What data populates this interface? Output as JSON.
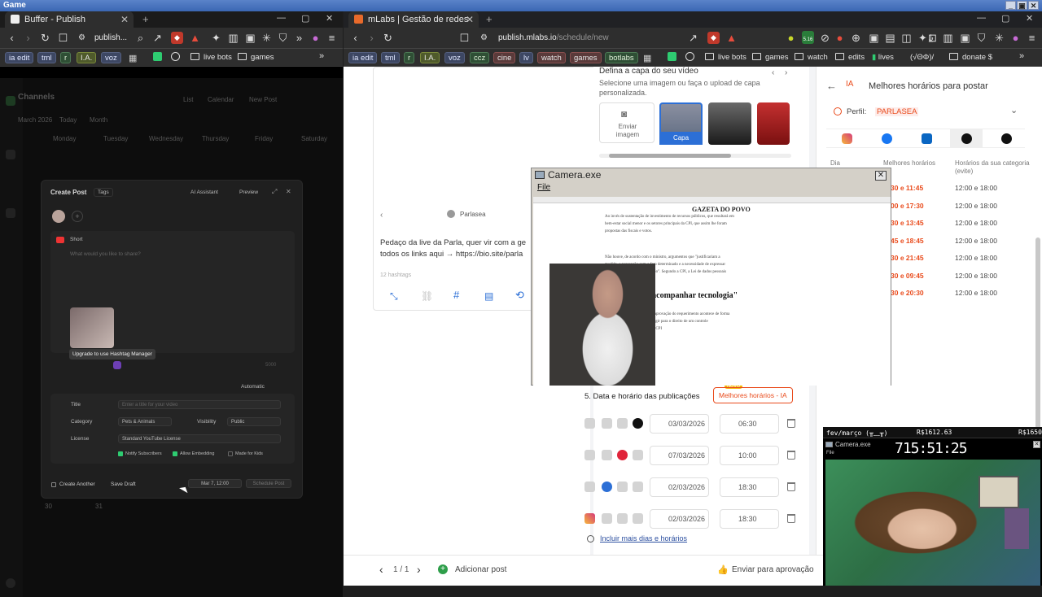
{
  "os": {
    "title": "Game",
    "controls": [
      "_",
      "▣",
      "✕"
    ]
  },
  "left_browser": {
    "tab": {
      "label": "Buffer - Publish",
      "close": "✕",
      "new": "+"
    },
    "win_controls": [
      "—",
      "▢",
      "✕"
    ],
    "url": "publish...",
    "bookmarks": [
      "ia edit",
      "tml",
      "r",
      "I.A.",
      "voz",
      "live bots",
      "games"
    ],
    "more": "»"
  },
  "buffer": {
    "sidebar_title": "Channels",
    "month": "March 2026",
    "today": "Today",
    "view": "Month",
    "list": "List",
    "calendar": "Calendar",
    "new_post": "New Post",
    "weekdays": [
      "Monday",
      "Tuesday",
      "Wednesday",
      "Thursday",
      "Friday",
      "Saturday"
    ],
    "dates": [
      "30",
      "31"
    ],
    "create_post": {
      "title": "Create Post",
      "tags": "Tags",
      "ai_assistant": "AI Assistant",
      "preview": "Preview",
      "format": "Short",
      "placeholder": "What would you like to share?",
      "tooltip": "Upgrade to use Hashtag Manager",
      "counter": "5000",
      "automatic": "Automatic",
      "title_label": "Title",
      "title_placeholder": "Enter a title for your video",
      "category_label": "Category",
      "category_value": "Pets & Animals",
      "visibility_label": "Visibility",
      "visibility_value": "Public",
      "license_label": "License",
      "license_value": "Standard YouTube License",
      "notify": "Notify Subscribers",
      "embedding": "Allow Embedding",
      "kids": "Made for Kids",
      "create_another": "Create Another",
      "save_draft": "Save Draft",
      "schedule_date": "Mar 7, 12:00",
      "schedule_post": "Schedule Post"
    }
  },
  "right_browser": {
    "tab": {
      "label": "mLabs | Gestão de redes sociais",
      "close": "✕",
      "new": "+"
    },
    "win_controls": [
      "—",
      "▢",
      "✕"
    ],
    "url_host": "publish.mlabs.io",
    "url_path": "/schedule/new",
    "ext_badge": "5.16",
    "bookmarks": [
      "ia edit",
      "tml",
      "r",
      "I.A.",
      "voz",
      "ccz",
      "cine",
      "lv",
      "watch",
      "games",
      "botlabs",
      "live bots",
      "games",
      "watch",
      "edits",
      "lives",
      "(√ΘΦ)/",
      "donate $"
    ],
    "more": "»"
  },
  "mlabs": {
    "cover_title": "Defina a capa do seu vídeo",
    "cover_desc": "Selecione uma imagem ou faça o upload de capa personalizada.",
    "send_image": "Enviar imagem",
    "cover_label": "Capa",
    "profile_name": "Parlasea",
    "caption_line1": "Pedaço da live da Parla, quer vir com a ge",
    "caption_line2": "todos os links aqui → https://bio.site/parla",
    "hashtags": "12 hashtags",
    "section5": "5. Data e horário das publicações",
    "new_badge": "NOVO",
    "best_times_btn": "Melhores horários - IA",
    "dates": [
      {
        "date": "03/03/2026",
        "time": "06:30"
      },
      {
        "date": "07/03/2026",
        "time": "10:00"
      },
      {
        "date": "02/03/2026",
        "time": "18:30"
      },
      {
        "date": "02/03/2026",
        "time": "18:30"
      }
    ],
    "more_days": "Incluir mais dias e horários",
    "pager": "1 / 1",
    "add_post": "Adicionar post",
    "send_approval": "Enviar para aprovação",
    "best": {
      "title": "Melhores horários para postar",
      "profile_label": "Perfil:",
      "profile_value": "PARLASEA",
      "col1": "Dia",
      "col2": "Melhores horários",
      "col3": "Horários da sua categoria (evite)",
      "best_times": [
        "30 e 11:45",
        "00 e 17:30",
        "30 e 13:45",
        "45 e 18:45",
        "30 e 21:45",
        "30 e 09:45",
        "30 e 20:30"
      ],
      "avoid": [
        "12:00 e 18:00",
        "12:00 e 18:00",
        "12:00 e 18:00",
        "12:00 e 18:00",
        "12:00 e 18:00",
        "12:00 e 18:00",
        "12:00 e 18:00"
      ]
    }
  },
  "camera": {
    "title": "Camera.exe",
    "menu": "File",
    "close": "✕",
    "article_site": "GAZETA DO POVO",
    "article_heading": "PL precisa \"acompanhar tecnologia\"",
    "article_text": [
      "Ao invés de sustentação de investimento de recursos públicos, que resultará em",
      "bem-estar social menor e os setores principais da CPI, que assim lhe foram",
      "propostas das fiscais e votos.",
      "Não houve, de acordo com o ministro, argumentos que \"justificariam a",
      "medida, a percepção com o fato determinado e a necessidade de expressar",
      "algo ao seu embaraço da cenário\". Segundo a CPI, a Lei de dados pessoais",
      "A bancada aponta ainda que a aprovação do requerimento acontece de forma",
      "que o presidente deve, assim, agir para o direito de um controle",
      "tenha condições para a própria CPI"
    ]
  },
  "stream": {
    "header_left": "fev/março (╥﹏╥)",
    "money1": "R$1612.63",
    "money2": "R$1650",
    "timer": "715:51:25",
    "cam_title": "Camera.exe",
    "cam_menu": "File"
  }
}
